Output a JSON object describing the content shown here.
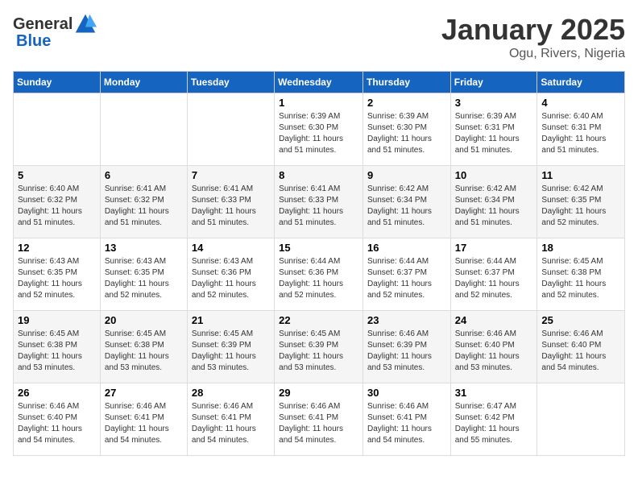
{
  "logo": {
    "general": "General",
    "blue": "Blue"
  },
  "title": "January 2025",
  "subtitle": "Ogu, Rivers, Nigeria",
  "days_of_week": [
    "Sunday",
    "Monday",
    "Tuesday",
    "Wednesday",
    "Thursday",
    "Friday",
    "Saturday"
  ],
  "weeks": [
    [
      {
        "day": "",
        "info": ""
      },
      {
        "day": "",
        "info": ""
      },
      {
        "day": "",
        "info": ""
      },
      {
        "day": "1",
        "info": "Sunrise: 6:39 AM\nSunset: 6:30 PM\nDaylight: 11 hours and 51 minutes."
      },
      {
        "day": "2",
        "info": "Sunrise: 6:39 AM\nSunset: 6:30 PM\nDaylight: 11 hours and 51 minutes."
      },
      {
        "day": "3",
        "info": "Sunrise: 6:39 AM\nSunset: 6:31 PM\nDaylight: 11 hours and 51 minutes."
      },
      {
        "day": "4",
        "info": "Sunrise: 6:40 AM\nSunset: 6:31 PM\nDaylight: 11 hours and 51 minutes."
      }
    ],
    [
      {
        "day": "5",
        "info": "Sunrise: 6:40 AM\nSunset: 6:32 PM\nDaylight: 11 hours and 51 minutes."
      },
      {
        "day": "6",
        "info": "Sunrise: 6:41 AM\nSunset: 6:32 PM\nDaylight: 11 hours and 51 minutes."
      },
      {
        "day": "7",
        "info": "Sunrise: 6:41 AM\nSunset: 6:33 PM\nDaylight: 11 hours and 51 minutes."
      },
      {
        "day": "8",
        "info": "Sunrise: 6:41 AM\nSunset: 6:33 PM\nDaylight: 11 hours and 51 minutes."
      },
      {
        "day": "9",
        "info": "Sunrise: 6:42 AM\nSunset: 6:34 PM\nDaylight: 11 hours and 51 minutes."
      },
      {
        "day": "10",
        "info": "Sunrise: 6:42 AM\nSunset: 6:34 PM\nDaylight: 11 hours and 51 minutes."
      },
      {
        "day": "11",
        "info": "Sunrise: 6:42 AM\nSunset: 6:35 PM\nDaylight: 11 hours and 52 minutes."
      }
    ],
    [
      {
        "day": "12",
        "info": "Sunrise: 6:43 AM\nSunset: 6:35 PM\nDaylight: 11 hours and 52 minutes."
      },
      {
        "day": "13",
        "info": "Sunrise: 6:43 AM\nSunset: 6:35 PM\nDaylight: 11 hours and 52 minutes."
      },
      {
        "day": "14",
        "info": "Sunrise: 6:43 AM\nSunset: 6:36 PM\nDaylight: 11 hours and 52 minutes."
      },
      {
        "day": "15",
        "info": "Sunrise: 6:44 AM\nSunset: 6:36 PM\nDaylight: 11 hours and 52 minutes."
      },
      {
        "day": "16",
        "info": "Sunrise: 6:44 AM\nSunset: 6:37 PM\nDaylight: 11 hours and 52 minutes."
      },
      {
        "day": "17",
        "info": "Sunrise: 6:44 AM\nSunset: 6:37 PM\nDaylight: 11 hours and 52 minutes."
      },
      {
        "day": "18",
        "info": "Sunrise: 6:45 AM\nSunset: 6:38 PM\nDaylight: 11 hours and 52 minutes."
      }
    ],
    [
      {
        "day": "19",
        "info": "Sunrise: 6:45 AM\nSunset: 6:38 PM\nDaylight: 11 hours and 53 minutes."
      },
      {
        "day": "20",
        "info": "Sunrise: 6:45 AM\nSunset: 6:38 PM\nDaylight: 11 hours and 53 minutes."
      },
      {
        "day": "21",
        "info": "Sunrise: 6:45 AM\nSunset: 6:39 PM\nDaylight: 11 hours and 53 minutes."
      },
      {
        "day": "22",
        "info": "Sunrise: 6:45 AM\nSunset: 6:39 PM\nDaylight: 11 hours and 53 minutes."
      },
      {
        "day": "23",
        "info": "Sunrise: 6:46 AM\nSunset: 6:39 PM\nDaylight: 11 hours and 53 minutes."
      },
      {
        "day": "24",
        "info": "Sunrise: 6:46 AM\nSunset: 6:40 PM\nDaylight: 11 hours and 53 minutes."
      },
      {
        "day": "25",
        "info": "Sunrise: 6:46 AM\nSunset: 6:40 PM\nDaylight: 11 hours and 54 minutes."
      }
    ],
    [
      {
        "day": "26",
        "info": "Sunrise: 6:46 AM\nSunset: 6:40 PM\nDaylight: 11 hours and 54 minutes."
      },
      {
        "day": "27",
        "info": "Sunrise: 6:46 AM\nSunset: 6:41 PM\nDaylight: 11 hours and 54 minutes."
      },
      {
        "day": "28",
        "info": "Sunrise: 6:46 AM\nSunset: 6:41 PM\nDaylight: 11 hours and 54 minutes."
      },
      {
        "day": "29",
        "info": "Sunrise: 6:46 AM\nSunset: 6:41 PM\nDaylight: 11 hours and 54 minutes."
      },
      {
        "day": "30",
        "info": "Sunrise: 6:46 AM\nSunset: 6:41 PM\nDaylight: 11 hours and 54 minutes."
      },
      {
        "day": "31",
        "info": "Sunrise: 6:47 AM\nSunset: 6:42 PM\nDaylight: 11 hours and 55 minutes."
      },
      {
        "day": "",
        "info": ""
      }
    ]
  ]
}
